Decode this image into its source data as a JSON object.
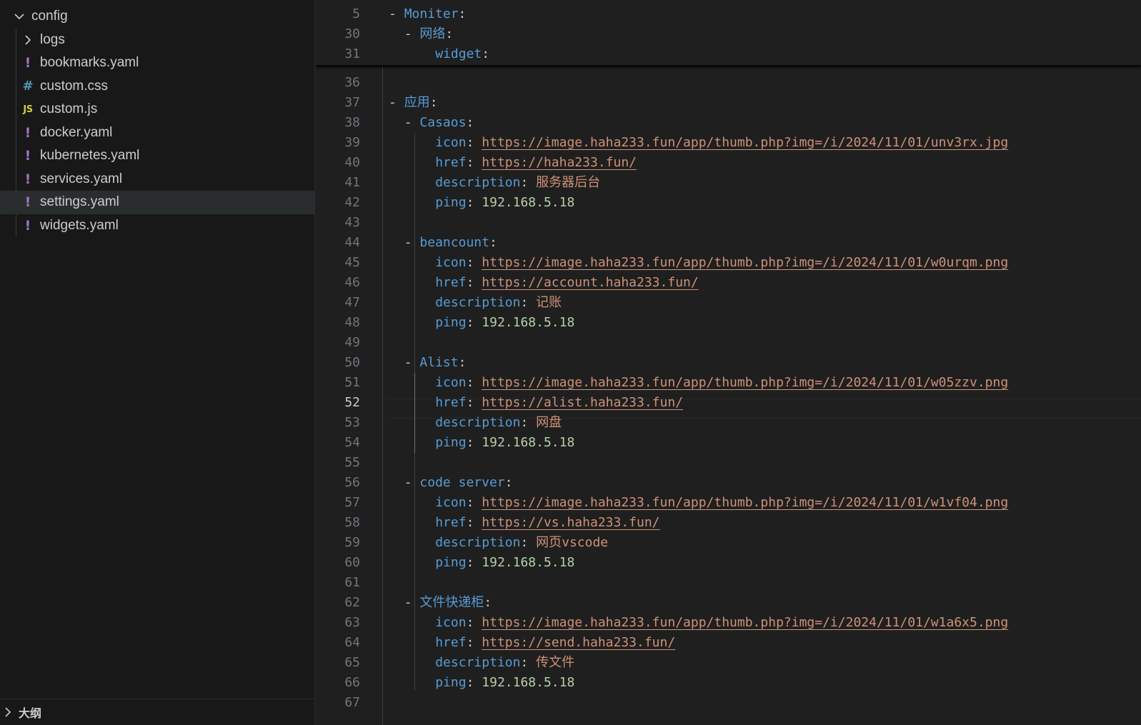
{
  "explorer": {
    "folder": "config",
    "items": [
      {
        "label": "logs",
        "kind": "folder"
      },
      {
        "label": "bookmarks.yaml",
        "kind": "yaml",
        "icon": "!"
      },
      {
        "label": "custom.css",
        "kind": "css",
        "icon": "#"
      },
      {
        "label": "custom.js",
        "kind": "js",
        "icon": "JS"
      },
      {
        "label": "docker.yaml",
        "kind": "yaml",
        "icon": "!"
      },
      {
        "label": "kubernetes.yaml",
        "kind": "yaml",
        "icon": "!"
      },
      {
        "label": "services.yaml",
        "kind": "yaml",
        "icon": "!"
      },
      {
        "label": "settings.yaml",
        "kind": "yaml",
        "icon": "!",
        "selected": true
      },
      {
        "label": "widgets.yaml",
        "kind": "yaml",
        "icon": "!"
      }
    ],
    "outline_label": "大纲"
  },
  "colors": {
    "key": "#569cd6",
    "string": "#ce9178",
    "number": "#b5cea8",
    "yaml_icon": "#a074c4",
    "css_icon": "#519aba",
    "js_icon": "#cbcb41"
  },
  "editor": {
    "active_line": 52,
    "sticky": [
      {
        "n": 5,
        "indent": 0,
        "dash": true,
        "key": "Moniter",
        "colon": ":"
      },
      {
        "n": 30,
        "indent": 1,
        "dash": true,
        "key": "网络",
        "colon": ":"
      },
      {
        "n": 31,
        "indent": 2,
        "dash": false,
        "key": "widget",
        "colon": ":"
      }
    ],
    "lines": [
      {
        "n": 36,
        "indent": 0
      },
      {
        "n": 37,
        "indent": 0,
        "dash": true,
        "key": "应用",
        "colon": ":"
      },
      {
        "n": 38,
        "indent": 1,
        "dash": true,
        "key": "Casaos",
        "colon": ":"
      },
      {
        "n": 39,
        "indent": 2,
        "key": "icon",
        "colon": ": ",
        "url": "https://image.haha233.fun/app/thumb.php?img=/i/2024/11/01/unv3rx.jpg"
      },
      {
        "n": 40,
        "indent": 2,
        "key": "href",
        "colon": ": ",
        "url": "https://haha233.fun/"
      },
      {
        "n": 41,
        "indent": 2,
        "key": "description",
        "colon": ": ",
        "str": "服务器后台"
      },
      {
        "n": 42,
        "indent": 2,
        "key": "ping",
        "colon": ": ",
        "num": "192.168.5.18"
      },
      {
        "n": 43,
        "indent": 0
      },
      {
        "n": 44,
        "indent": 1,
        "dash": true,
        "key": "beancount",
        "colon": ":"
      },
      {
        "n": 45,
        "indent": 2,
        "key": "icon",
        "colon": ": ",
        "url": "https://image.haha233.fun/app/thumb.php?img=/i/2024/11/01/w0urqm.png"
      },
      {
        "n": 46,
        "indent": 2,
        "key": "href",
        "colon": ": ",
        "url": "https://account.haha233.fun/"
      },
      {
        "n": 47,
        "indent": 2,
        "key": "description",
        "colon": ": ",
        "str": "记账"
      },
      {
        "n": 48,
        "indent": 2,
        "key": "ping",
        "colon": ": ",
        "num": "192.168.5.18"
      },
      {
        "n": 49,
        "indent": 0
      },
      {
        "n": 50,
        "indent": 1,
        "dash": true,
        "key": "Alist",
        "colon": ":"
      },
      {
        "n": 51,
        "indent": 2,
        "key": "icon",
        "colon": ": ",
        "url": "https://image.haha233.fun/app/thumb.php?img=/i/2024/11/01/w05zzv.png"
      },
      {
        "n": 52,
        "indent": 2,
        "key": "href",
        "colon": ": ",
        "url": "https://alist.haha233.fun/"
      },
      {
        "n": 53,
        "indent": 2,
        "key": "description",
        "colon": ": ",
        "str": "网盘"
      },
      {
        "n": 54,
        "indent": 2,
        "key": "ping",
        "colon": ": ",
        "num": "192.168.5.18"
      },
      {
        "n": 55,
        "indent": 0
      },
      {
        "n": 56,
        "indent": 1,
        "dash": true,
        "key": "code server",
        "colon": ":"
      },
      {
        "n": 57,
        "indent": 2,
        "key": "icon",
        "colon": ": ",
        "url": "https://image.haha233.fun/app/thumb.php?img=/i/2024/11/01/w1vf04.png"
      },
      {
        "n": 58,
        "indent": 2,
        "key": "href",
        "colon": ": ",
        "url": "https://vs.haha233.fun/"
      },
      {
        "n": 59,
        "indent": 2,
        "key": "description",
        "colon": ": ",
        "str": "网页vscode"
      },
      {
        "n": 60,
        "indent": 2,
        "key": "ping",
        "colon": ": ",
        "num": "192.168.5.18"
      },
      {
        "n": 61,
        "indent": 0
      },
      {
        "n": 62,
        "indent": 1,
        "dash": true,
        "key": "文件快递柜",
        "colon": ":"
      },
      {
        "n": 63,
        "indent": 2,
        "key": "icon",
        "colon": ": ",
        "url": "https://image.haha233.fun/app/thumb.php?img=/i/2024/11/01/w1a6x5.png"
      },
      {
        "n": 64,
        "indent": 2,
        "key": "href",
        "colon": ": ",
        "url": "https://send.haha233.fun/"
      },
      {
        "n": 65,
        "indent": 2,
        "key": "description",
        "colon": ": ",
        "str": "传文件"
      },
      {
        "n": 66,
        "indent": 2,
        "key": "ping",
        "colon": ": ",
        "num": "192.168.5.18"
      },
      {
        "n": 67,
        "indent": 0
      }
    ]
  }
}
